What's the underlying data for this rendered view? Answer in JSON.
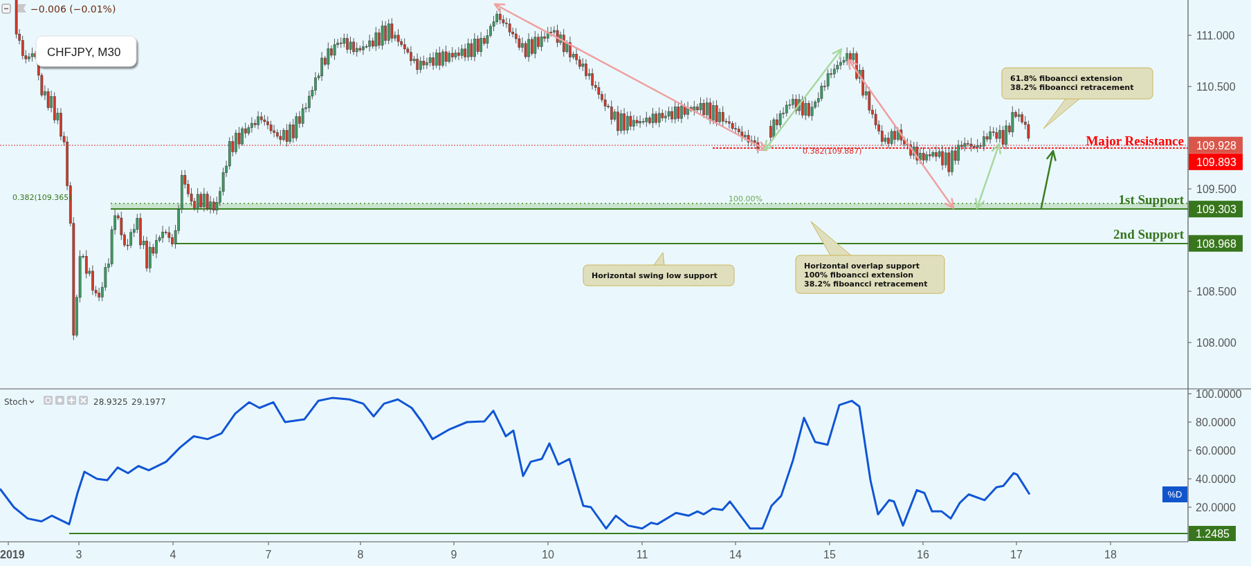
{
  "header": {
    "change": "−0.006 (−0.01%)"
  },
  "symbol_label": "CHFJPY, M30",
  "price_axis": {
    "labels": [
      "111.000",
      "110.500",
      "109.500",
      "108.500",
      "108.000"
    ]
  },
  "price_tags": [
    {
      "value": "109.928",
      "color": "#d9574a"
    },
    {
      "value": "109.893",
      "color": "#ff0000"
    },
    {
      "value": "109.303",
      "color": "#38761d"
    },
    {
      "value": "108.968",
      "color": "#38761d"
    }
  ],
  "level_labels": [
    {
      "text": "Major Resistance",
      "color": "#ff0000"
    },
    {
      "text": "1st Support",
      "color": "#38761d"
    },
    {
      "text": "2nd Support",
      "color": "#38761d"
    }
  ],
  "fib_labels": [
    {
      "text": "0.382(109.365)",
      "color": "#38761d"
    },
    {
      "text": "100.00%",
      "color": "#6aa84f"
    },
    {
      "text": "0.382(109.887)",
      "color": "#e0201b"
    }
  ],
  "callouts": [
    {
      "lines": [
        "61.8% fiboancci extension",
        "38.2% fiboancci retracement"
      ]
    },
    {
      "lines": [
        "Horizontal swing low support"
      ]
    },
    {
      "lines": [
        "Horizontal overlap support",
        "100% fiboancci extension",
        "38.2% fiboancci retracement"
      ]
    }
  ],
  "stoch": {
    "name": "Stoch",
    "values": [
      "28.9325",
      "29.1977"
    ],
    "axis_labels": [
      "100.0000",
      "80.0000",
      "60.0000",
      "40.0000",
      "20.0000"
    ],
    "tags": [
      {
        "text": "%D",
        "color": "#1155cc"
      },
      {
        "text": "1.2485",
        "color": "#38761d"
      }
    ]
  },
  "time_axis": [
    "2019",
    "3",
    "4",
    "7",
    "8",
    "9",
    "10",
    "11",
    "14",
    "15",
    "16",
    "17",
    "18"
  ]
}
